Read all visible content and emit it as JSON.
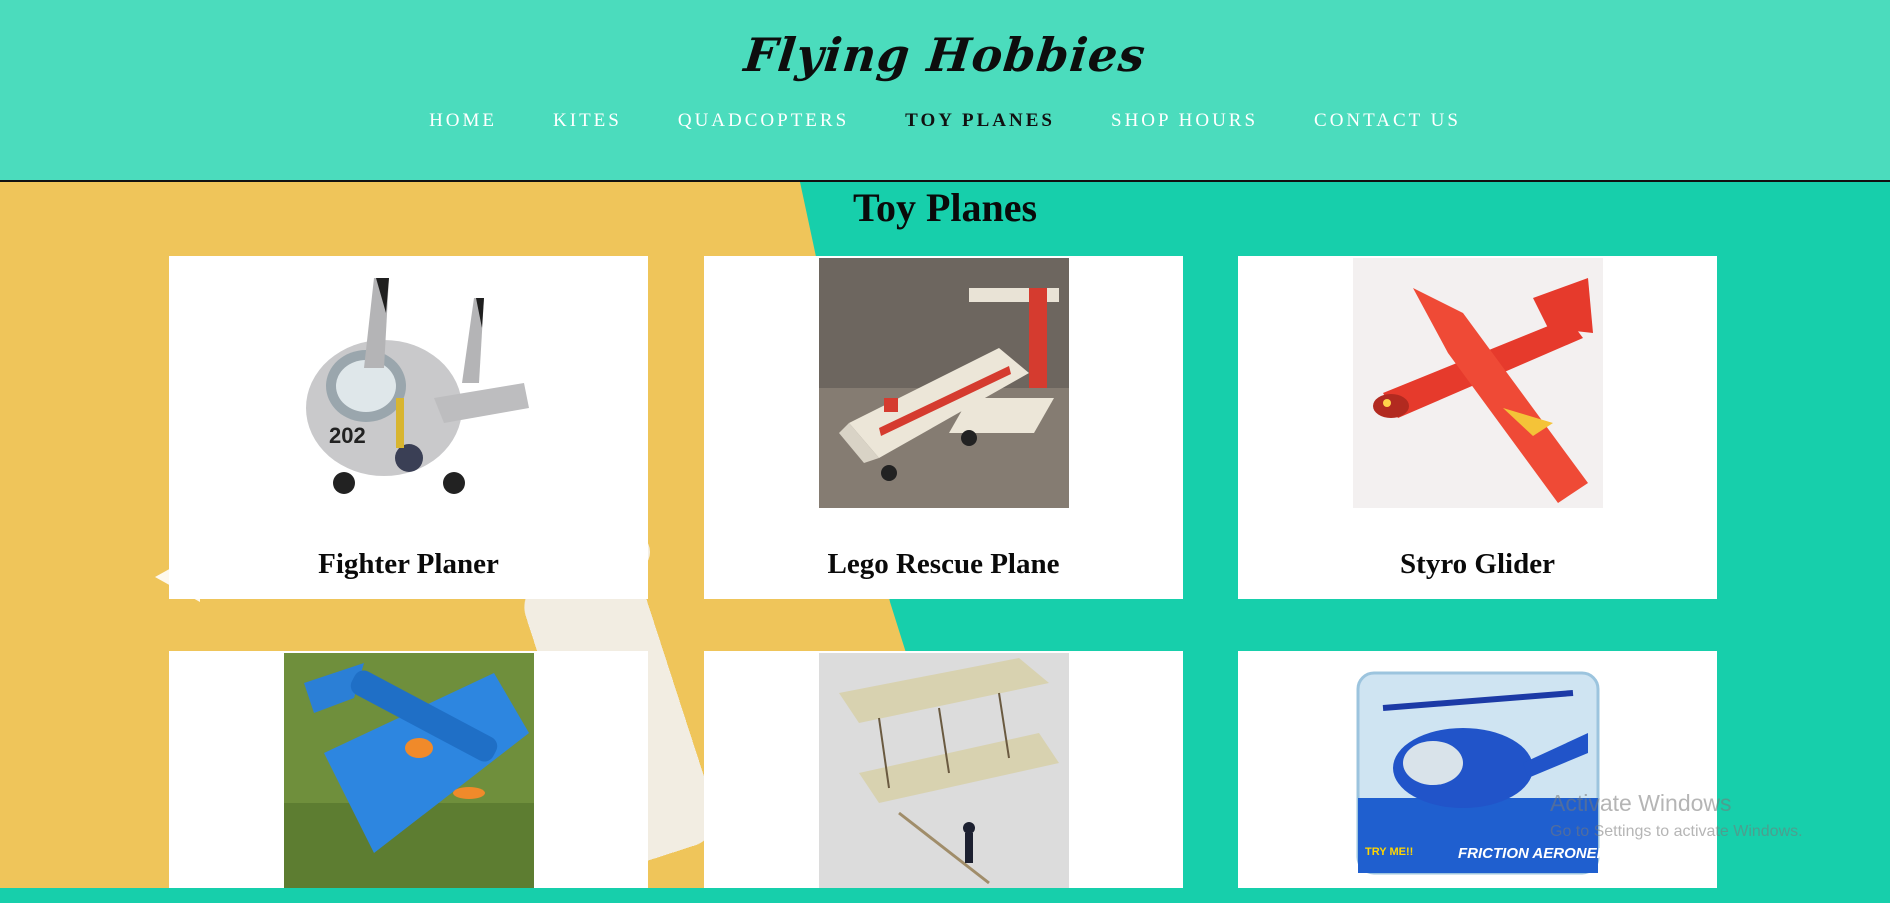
{
  "site": {
    "logo_text": "Flying Hobbies"
  },
  "nav": {
    "items": [
      {
        "label": "HOME",
        "active": false
      },
      {
        "label": "KITES",
        "active": false
      },
      {
        "label": "QUADCOPTERS",
        "active": false
      },
      {
        "label": "TOY PLANES",
        "active": true
      },
      {
        "label": "SHOP HOURS",
        "active": false
      },
      {
        "label": "CONTACT US",
        "active": false
      }
    ]
  },
  "page": {
    "title": "Toy Planes"
  },
  "products": [
    {
      "name": "Fighter Planer",
      "image": "cartoon-fighter-jet"
    },
    {
      "name": "Lego Rescue Plane",
      "image": "lego-rescue-plane"
    },
    {
      "name": "Styro Glider",
      "image": "red-foam-glider"
    },
    {
      "name": "",
      "image": "blue-foam-rc-plane"
    },
    {
      "name": "",
      "image": "wright-flyer-model"
    },
    {
      "name": "",
      "image": "blue-toy-helicopter-box"
    }
  ],
  "watermark": {
    "line1": "Activate Windows",
    "line2": "Go to Settings to activate Windows."
  },
  "colors": {
    "header_bg": "#4bdcbd",
    "hero_teal": "#17cfab",
    "hero_yellow": "#efc55a",
    "nav_text": "#ffffff",
    "nav_active": "#111111"
  }
}
